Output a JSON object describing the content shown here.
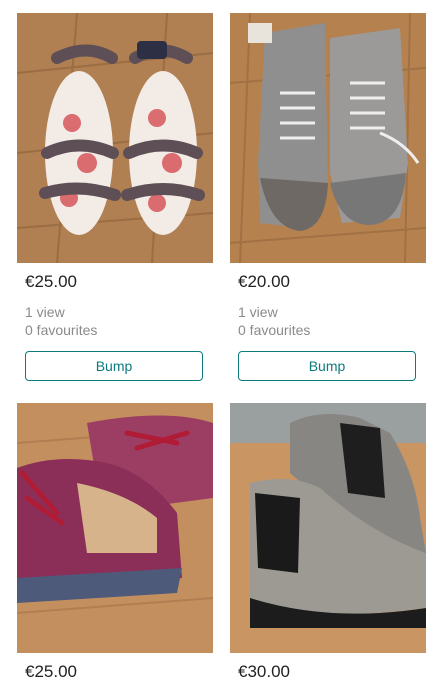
{
  "listings": [
    {
      "price": "€25.00",
      "views": "1 view",
      "favourites": "0 favourites",
      "bump_label": "Bump",
      "image": "sandals-with-floral-insoles"
    },
    {
      "price": "€20.00",
      "views": "1 view",
      "favourites": "0 favourites",
      "bump_label": "Bump",
      "image": "grey-lace-up-ankle-boots"
    },
    {
      "price": "€25.00",
      "image": "purple-lace-up-shoes"
    },
    {
      "price": "€30.00",
      "image": "silver-chelsea-boots"
    }
  ],
  "colors": {
    "accent": "#0d7b7d",
    "price_text": "#222222",
    "meta_text": "#8a8a8a"
  }
}
